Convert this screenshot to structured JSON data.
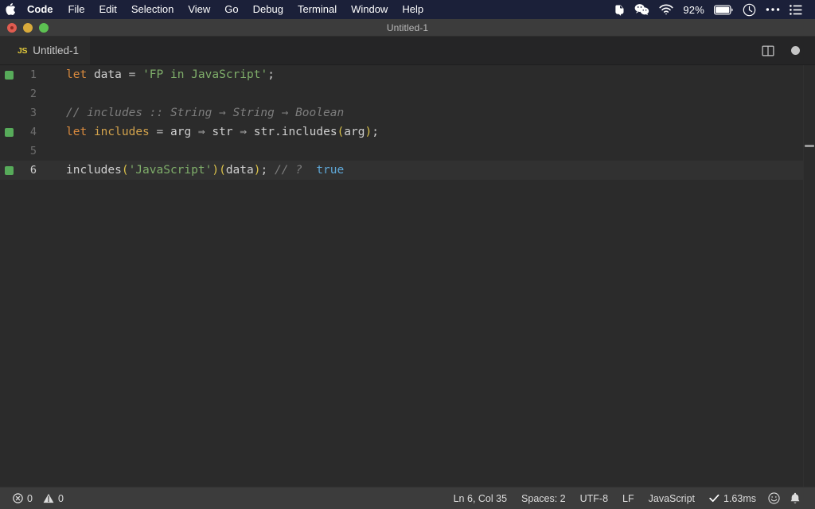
{
  "menubar": {
    "apple_icon": "apple-logo-icon",
    "items": [
      {
        "label": "Code",
        "bold": true
      },
      {
        "label": "File",
        "bold": false
      },
      {
        "label": "Edit",
        "bold": false
      },
      {
        "label": "Selection",
        "bold": false
      },
      {
        "label": "View",
        "bold": false
      },
      {
        "label": "Go",
        "bold": false
      },
      {
        "label": "Debug",
        "bold": false
      },
      {
        "label": "Terminal",
        "bold": false
      },
      {
        "label": "Window",
        "bold": false
      },
      {
        "label": "Help",
        "bold": false
      }
    ],
    "tray": {
      "evernote_icon": "evernote-icon",
      "wechat_icon": "wechat-icon",
      "wifi_icon": "wifi-icon",
      "battery_percent": "92%",
      "battery_icon": "battery-icon",
      "clock_icon": "clock-icon",
      "overflow_icon": "ellipsis-icon",
      "controlcenter_icon": "list-icon"
    }
  },
  "window": {
    "title": "Untitled-1",
    "traffic_lights": {
      "close": "close-button",
      "minimize": "minimize-button",
      "maximize": "maximize-button"
    }
  },
  "tabbar": {
    "tab": {
      "icon_label": "JS",
      "label": "Untitled-1"
    },
    "actions": {
      "split_editor_icon": "split-editor-icon",
      "dirty_indicator": "unsaved-dot-icon"
    }
  },
  "editor": {
    "lines": [
      {
        "number": "1",
        "marker": true,
        "active": false,
        "tokens": [
          {
            "text": "let",
            "cls": "t-kw"
          },
          {
            "text": " ",
            "cls": "t-plain"
          },
          {
            "text": "data",
            "cls": "t-ident"
          },
          {
            "text": " ",
            "cls": "t-plain"
          },
          {
            "text": "=",
            "cls": "t-op"
          },
          {
            "text": " ",
            "cls": "t-plain"
          },
          {
            "text": "'FP in JavaScript'",
            "cls": "t-str"
          },
          {
            "text": ";",
            "cls": "t-plain"
          }
        ]
      },
      {
        "number": "2",
        "marker": false,
        "active": false,
        "tokens": []
      },
      {
        "number": "3",
        "marker": false,
        "active": false,
        "tokens": [
          {
            "text": "// includes :: String → String → Boolean",
            "cls": "t-comment"
          }
        ]
      },
      {
        "number": "4",
        "marker": true,
        "active": false,
        "tokens": [
          {
            "text": "let",
            "cls": "t-kw"
          },
          {
            "text": " ",
            "cls": "t-plain"
          },
          {
            "text": "includes",
            "cls": "t-fnname"
          },
          {
            "text": " ",
            "cls": "t-plain"
          },
          {
            "text": "=",
            "cls": "t-op"
          },
          {
            "text": " ",
            "cls": "t-plain"
          },
          {
            "text": "arg",
            "cls": "t-ident"
          },
          {
            "text": " ",
            "cls": "t-plain"
          },
          {
            "text": "⇒",
            "cls": "t-op"
          },
          {
            "text": " ",
            "cls": "t-plain"
          },
          {
            "text": "str",
            "cls": "t-ident"
          },
          {
            "text": " ",
            "cls": "t-plain"
          },
          {
            "text": "⇒",
            "cls": "t-op"
          },
          {
            "text": " ",
            "cls": "t-plain"
          },
          {
            "text": "str.includes",
            "cls": "t-ident"
          },
          {
            "text": "(",
            "cls": "t-punct"
          },
          {
            "text": "arg",
            "cls": "t-ident"
          },
          {
            "text": ")",
            "cls": "t-punct"
          },
          {
            "text": ";",
            "cls": "t-plain"
          }
        ]
      },
      {
        "number": "5",
        "marker": false,
        "active": false,
        "tokens": []
      },
      {
        "number": "6",
        "marker": true,
        "active": true,
        "tokens": [
          {
            "text": "includes",
            "cls": "t-ident"
          },
          {
            "text": "(",
            "cls": "t-punct"
          },
          {
            "text": "'JavaScript'",
            "cls": "t-str"
          },
          {
            "text": ")",
            "cls": "t-punct"
          },
          {
            "text": "(",
            "cls": "t-punct"
          },
          {
            "text": "data",
            "cls": "t-ident"
          },
          {
            "text": ")",
            "cls": "t-punct"
          },
          {
            "text": ";",
            "cls": "t-plain"
          },
          {
            "text": " ",
            "cls": "t-plain"
          },
          {
            "text": "// ?",
            "cls": "t-comment"
          },
          {
            "text": "  ",
            "cls": "t-plain"
          },
          {
            "text": "true",
            "cls": "t-bool"
          }
        ]
      }
    ]
  },
  "statusbar": {
    "errors_icon": "error-circle-icon",
    "errors_count": "0",
    "warnings_icon": "warning-triangle-icon",
    "warnings_count": "0",
    "cursor_position": "Ln 6, Col 35",
    "indentation": "Spaces: 2",
    "encoding": "UTF-8",
    "eol": "LF",
    "language": "JavaScript",
    "runtime_check_icon": "check-icon",
    "runtime_time": "1.63ms",
    "feedback_icon": "smiley-icon",
    "notifications_icon": "bell-icon"
  }
}
